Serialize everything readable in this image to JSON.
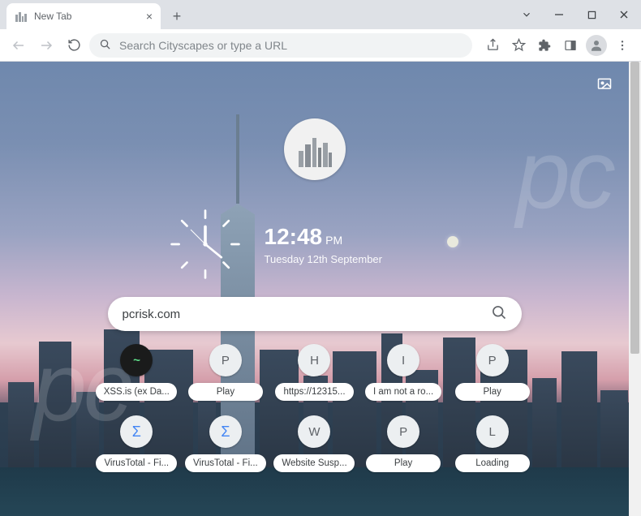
{
  "window": {
    "tab_title": "New Tab"
  },
  "toolbar": {
    "omnibox_placeholder": "Search Cityscapes or type a URL"
  },
  "widget": {
    "time": "12:48",
    "ampm": "PM",
    "date": "Tuesday 12th September"
  },
  "search": {
    "value": "pcrisk.com"
  },
  "shortcuts": [
    {
      "letter": "~",
      "label": "XSS.is (ex Da...",
      "dark": true
    },
    {
      "letter": "P",
      "label": "Play"
    },
    {
      "letter": "H",
      "label": "https://12315..."
    },
    {
      "letter": "I",
      "label": "I am not a ro..."
    },
    {
      "letter": "P",
      "label": "Play"
    },
    {
      "letter": "Σ",
      "label": "VirusTotal - Fi...",
      "sigma": true
    },
    {
      "letter": "Σ",
      "label": "VirusTotal - Fi...",
      "sigma": true
    },
    {
      "letter": "W",
      "label": "Website Susp..."
    },
    {
      "letter": "P",
      "label": "Play"
    },
    {
      "letter": "L",
      "label": "Loading"
    }
  ]
}
